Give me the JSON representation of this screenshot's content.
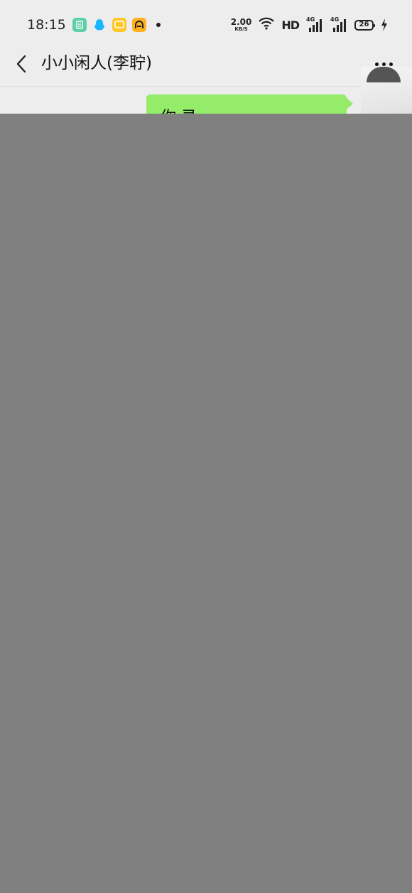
{
  "status_bar": {
    "time": "18:15",
    "notification_icons": [
      "wechat-sim-icon",
      "qq-icon",
      "message-icon",
      "reader-app-icon"
    ],
    "net_speed_value": "2.00",
    "net_speed_unit": "KB/S",
    "hd_label": "HD",
    "signal1_label": "4G",
    "signal2_label": "4G",
    "battery_level": "26"
  },
  "header": {
    "title": "小小闲人(李聍)",
    "back_icon": "chevron-left-icon",
    "more_icon": "more-dots-icon"
  },
  "chat": {
    "message_text": "你 录",
    "bubble_color": "#95ec69"
  },
  "colors": {
    "background": "#ededed",
    "overlay": "#808080"
  }
}
